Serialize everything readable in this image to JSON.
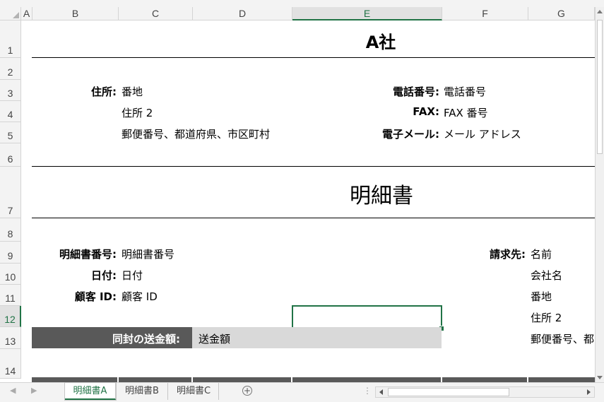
{
  "columns": [
    "A",
    "B",
    "C",
    "D",
    "E",
    "F",
    "G"
  ],
  "rows": [
    "1",
    "2",
    "3",
    "4",
    "5",
    "6",
    "7",
    "8",
    "9",
    "10",
    "11",
    "12",
    "13",
    "14"
  ],
  "company": {
    "name": "A社"
  },
  "address": {
    "label": "住所:",
    "line1": "番地",
    "line2": "住所 2",
    "line3": "郵便番号、都道府県、市区町村"
  },
  "contact": {
    "phone_label": "電話番号:",
    "phone_value": "電話番号",
    "fax_label": "FAX:",
    "fax_value": "FAX 番号",
    "email_label": "電子メール:",
    "email_value": "メール アドレス"
  },
  "doc_title": "明細書",
  "statement": {
    "number_label": "明細書番号:",
    "number_value": "明細書番号",
    "date_label": "日付:",
    "date_value": "日付",
    "customer_label": "顧客 ID:",
    "customer_value": "顧客 ID"
  },
  "billing": {
    "label": "請求先:",
    "name": "名前",
    "company": "会社名",
    "street": "番地",
    "address2": "住所 2",
    "postal": "郵便番号、都"
  },
  "remittance": {
    "label": "同封の送金額:",
    "value": "送金額"
  },
  "tabs": [
    {
      "label": "明細書A",
      "active": true
    },
    {
      "label": "明細書B",
      "active": false
    },
    {
      "label": "明細書C",
      "active": false
    }
  ],
  "colors": {
    "accent": "#217346",
    "dark_band": "#595959",
    "light_band": "#d9d9d9"
  }
}
